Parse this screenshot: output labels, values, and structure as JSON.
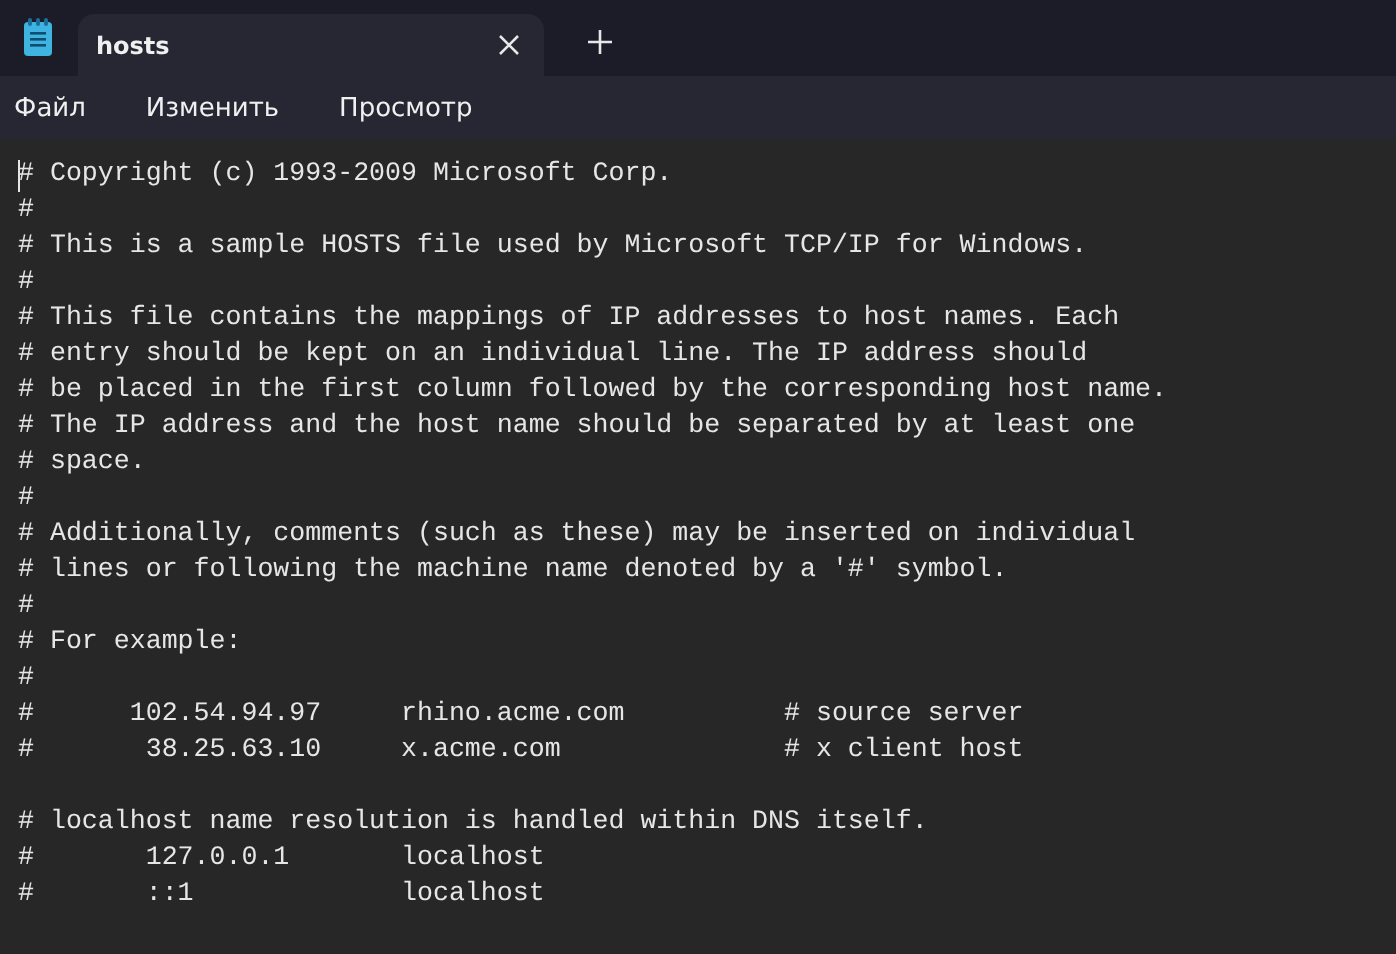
{
  "tabs": [
    {
      "label": "hosts",
      "selected": true
    }
  ],
  "menu": [
    "Файл",
    "Изменить",
    "Просмотр"
  ],
  "editor": {
    "blocks": [
      [
        "# Copyright (c) 1993-2009 Microsoft Corp.",
        "#",
        "# This is a sample HOSTS file used by Microsoft TCP/IP for Windows.",
        "#",
        "# This file contains the mappings of IP addresses to host names. Each",
        "# entry should be kept on an individual line. The IP address should",
        "# be placed in the first column followed by the corresponding host name.",
        "# The IP address and the host name should be separated by at least one",
        "# space.",
        "#",
        "# Additionally, comments (such as these) may be inserted on individual",
        "# lines or following the machine name denoted by a '#' symbol.",
        "#",
        "# For example:",
        "#",
        "#      102.54.94.97     rhino.acme.com          # source server",
        "#       38.25.63.10     x.acme.com              # x client host"
      ],
      [
        "# localhost name resolution is handled within DNS itself.",
        "#       127.0.0.1       localhost",
        "#       ::1             localhost"
      ]
    ]
  }
}
